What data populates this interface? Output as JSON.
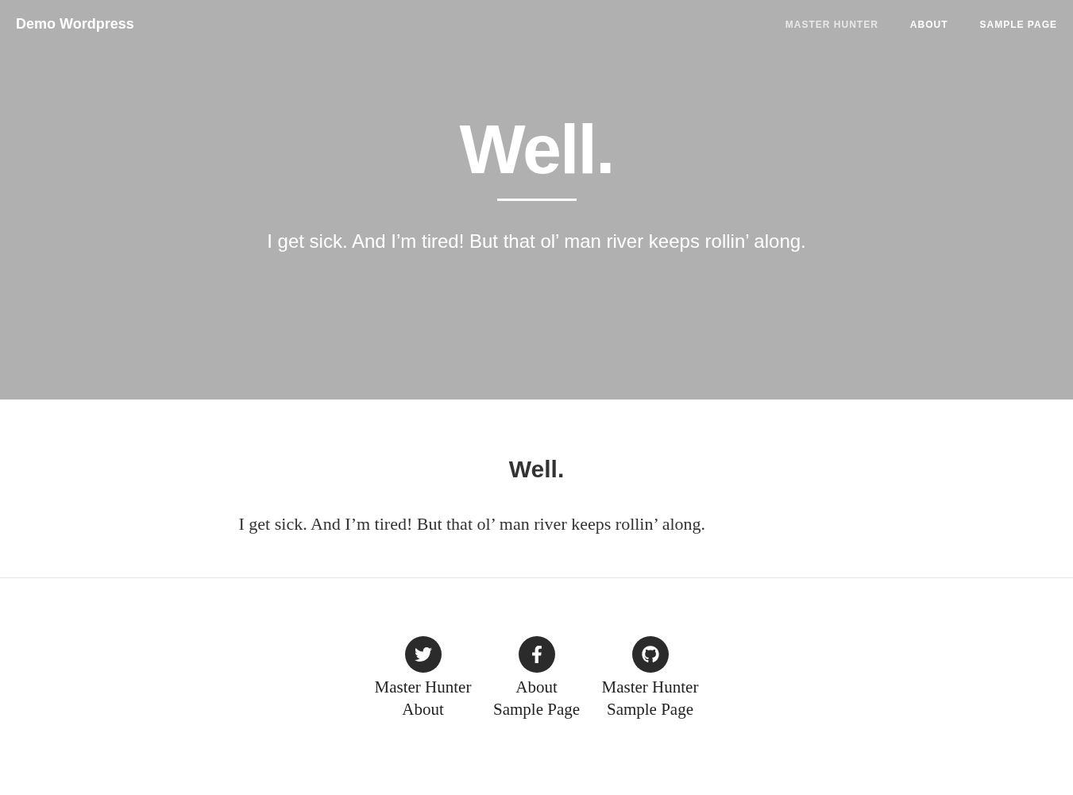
{
  "header": {
    "brand": "Demo Wordpress",
    "nav": [
      {
        "label": "MASTER HUNTER",
        "selected": true
      },
      {
        "label": "ABOUT",
        "selected": false
      },
      {
        "label": "SAMPLE PAGE",
        "selected": false
      }
    ]
  },
  "hero": {
    "title": "Well.",
    "subtitle": "I get sick. And I’m tired! But that ol’ man river keeps rollin’ along."
  },
  "post": {
    "title": "Well.",
    "body": "I get sick. And I’m tired! But that ol’ man river keeps rollin’ along."
  },
  "footer": {
    "social": [
      {
        "kind": "twitter",
        "links": [
          "Master Hunter",
          "About"
        ]
      },
      {
        "kind": "facebook",
        "links": [
          "About",
          "Sample Page"
        ]
      },
      {
        "kind": "github",
        "links": [
          "Master Hunter",
          "Sample Page"
        ]
      }
    ]
  }
}
